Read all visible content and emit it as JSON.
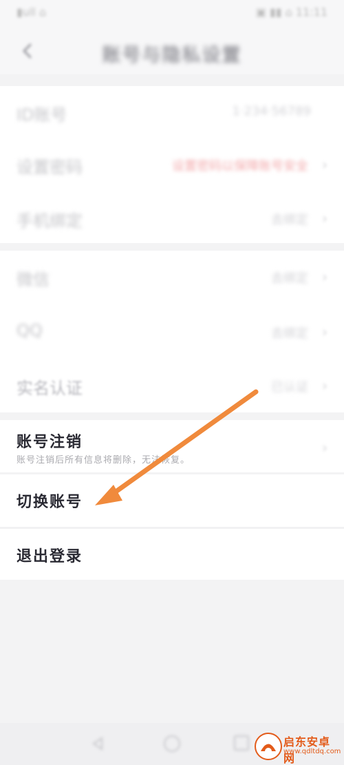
{
  "status_bar": {
    "left": "▮ull ⌂",
    "right": "▣ ▮▮ ⌂ 11:11"
  },
  "nav": {
    "title": "账号与隐私设置"
  },
  "section1": [
    {
      "label": "ID账号",
      "value": "1·234·56789"
    },
    {
      "label": "设置密码",
      "value": "设置密码以保障账号安全"
    },
    {
      "label": "手机绑定",
      "value": "去绑定"
    }
  ],
  "section2": [
    {
      "label": "微信",
      "value": "去绑定"
    },
    {
      "label": "QQ",
      "value": "去绑定"
    },
    {
      "label": "实名认证",
      "value": "已认证"
    }
  ],
  "account_cancel": {
    "title": "账号注销",
    "subtitle": "账号注销后所有信息将删除，无法恢复。"
  },
  "switch_account": {
    "label": "切换账号"
  },
  "logout": {
    "label": "退出登录"
  },
  "watermark": {
    "name": "启东安卓网",
    "url": "www.qdltdq.com"
  },
  "colors": {
    "arrow": "#f08a3c",
    "warning_red": "#f2a9ab",
    "brand_orange": "#e35b1a"
  }
}
